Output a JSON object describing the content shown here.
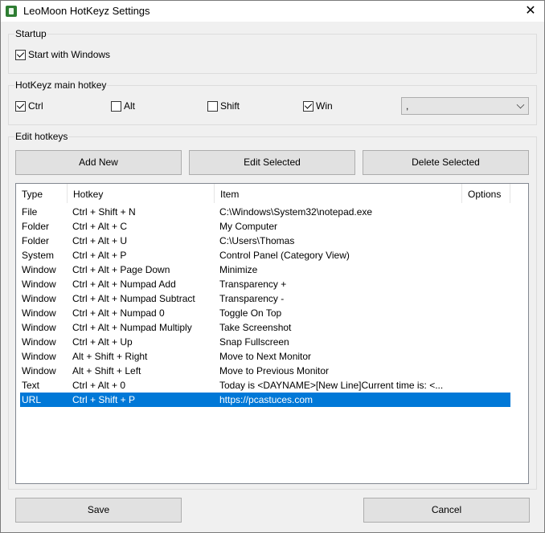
{
  "window": {
    "title": "LeoMoon HotKeyz Settings",
    "close_symbol": "✕"
  },
  "startup": {
    "legend": "Startup",
    "start_with_windows": {
      "label": "Start with Windows",
      "checked": true
    }
  },
  "main_hotkey": {
    "legend": "HotKeyz main hotkey",
    "ctrl": {
      "label": "Ctrl",
      "checked": true
    },
    "alt": {
      "label": "Alt",
      "checked": false
    },
    "shift": {
      "label": "Shift",
      "checked": false
    },
    "win": {
      "label": "Win",
      "checked": true
    },
    "key_value": ","
  },
  "edit_hotkeys": {
    "legend": "Edit hotkeys",
    "add_new": "Add New",
    "edit_selected": "Edit Selected",
    "delete_selected": "Delete Selected",
    "columns": [
      "Type",
      "Hotkey",
      "Item",
      "Options"
    ],
    "rows": [
      {
        "type": "File",
        "hotkey": "Ctrl + Shift + N",
        "item": "C:\\Windows\\System32\\notepad.exe",
        "options": ""
      },
      {
        "type": "Folder",
        "hotkey": "Ctrl + Alt + C",
        "item": "My Computer",
        "options": ""
      },
      {
        "type": "Folder",
        "hotkey": "Ctrl + Alt + U",
        "item": "C:\\Users\\Thomas",
        "options": ""
      },
      {
        "type": "System",
        "hotkey": "Ctrl + Alt + P",
        "item": "Control Panel (Category View)",
        "options": ""
      },
      {
        "type": "Window",
        "hotkey": "Ctrl + Alt + Page Down",
        "item": "Minimize",
        "options": ""
      },
      {
        "type": "Window",
        "hotkey": "Ctrl + Alt + Numpad Add",
        "item": "Transparency +",
        "options": ""
      },
      {
        "type": "Window",
        "hotkey": "Ctrl + Alt + Numpad Subtract",
        "item": "Transparency -",
        "options": ""
      },
      {
        "type": "Window",
        "hotkey": "Ctrl + Alt + Numpad 0",
        "item": "Toggle On Top",
        "options": ""
      },
      {
        "type": "Window",
        "hotkey": "Ctrl + Alt + Numpad Multiply",
        "item": "Take Screenshot",
        "options": ""
      },
      {
        "type": "Window",
        "hotkey": "Ctrl + Alt + Up",
        "item": "Snap Fullscreen",
        "options": ""
      },
      {
        "type": "Window",
        "hotkey": "Alt + Shift + Right",
        "item": "Move to Next Monitor",
        "options": ""
      },
      {
        "type": "Window",
        "hotkey": "Alt + Shift + Left",
        "item": "Move to Previous Monitor",
        "options": ""
      },
      {
        "type": "Text",
        "hotkey": "Ctrl + Alt + 0",
        "item": "Today is <DAYNAME>[New Line]Current time is: <...",
        "options": ""
      },
      {
        "type": "URL",
        "hotkey": "Ctrl + Shift + P",
        "item": "https://pcastuces.com",
        "options": "",
        "selected": true
      }
    ]
  },
  "footer": {
    "save": "Save",
    "cancel": "Cancel"
  },
  "colors": {
    "selection": "#0078d7",
    "window_bg": "#f0f0f0",
    "app_icon": "#2e7d32"
  }
}
